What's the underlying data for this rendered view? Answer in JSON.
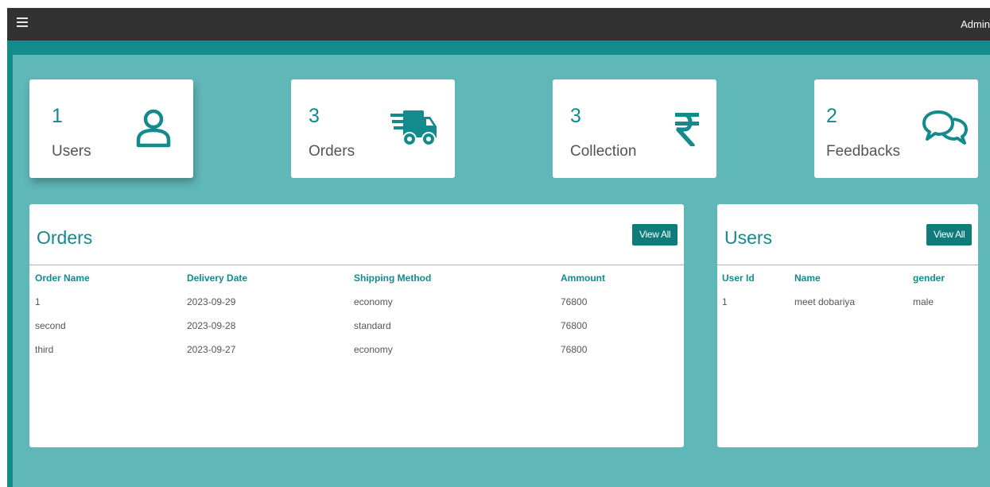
{
  "header": {
    "menu_icon": "hamburger-icon",
    "user": "Admin"
  },
  "stats": [
    {
      "count": "1",
      "label": "Users",
      "icon": "user-icon"
    },
    {
      "count": "3",
      "label": "Orders",
      "icon": "truck-icon"
    },
    {
      "count": "3",
      "label": "Collection",
      "icon": "rupee-icon"
    },
    {
      "count": "2",
      "label": "Feedbacks",
      "icon": "chat-bubbles-icon"
    }
  ],
  "orders_panel": {
    "title": "Orders",
    "view_all": "View All",
    "columns": [
      "Order Name",
      "Delivery Date",
      "Shipping Method",
      "Ammount"
    ],
    "rows": [
      [
        "1",
        "2023-09-29",
        "economy",
        "76800"
      ],
      [
        "second",
        "2023-09-28",
        "standard",
        "76800"
      ],
      [
        "third",
        "2023-09-27",
        "economy",
        "76800"
      ]
    ]
  },
  "users_panel": {
    "title": "Users",
    "view_all": "View All",
    "columns": [
      "User Id",
      "Name",
      "gender"
    ],
    "rows": [
      [
        "1",
        "meet dobariya",
        "male"
      ]
    ]
  },
  "colors": {
    "accent": "#138a8c",
    "background": "#60b7b8",
    "topbar": "#323232",
    "button": "#0e7c7b"
  }
}
